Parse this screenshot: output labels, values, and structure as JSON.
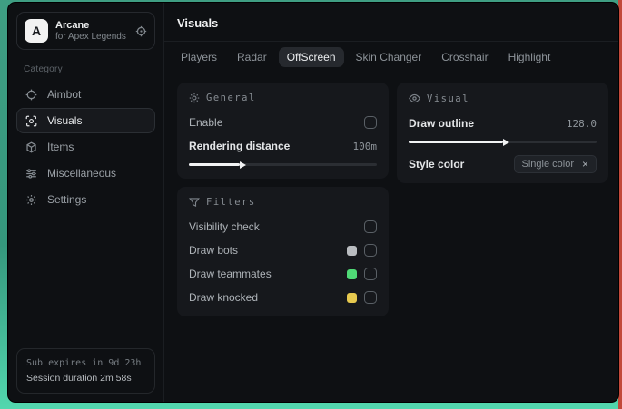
{
  "app": {
    "logo_letter": "A",
    "name": "Arcane",
    "subtitle": "for Apex Legends"
  },
  "sidebar": {
    "category_label": "Category",
    "items": [
      {
        "label": "Aimbot"
      },
      {
        "label": "Visuals"
      },
      {
        "label": "Items"
      },
      {
        "label": "Miscellaneous"
      },
      {
        "label": "Settings"
      }
    ],
    "footer": {
      "sub_expires": "Sub expires in 9d 23h",
      "session_duration": "Session duration 2m 58s"
    }
  },
  "main": {
    "title": "Visuals",
    "tabs": [
      {
        "label": "Players"
      },
      {
        "label": "Radar"
      },
      {
        "label": "OffScreen"
      },
      {
        "label": "Skin Changer"
      },
      {
        "label": "Crosshair"
      },
      {
        "label": "Highlight"
      }
    ],
    "panels": {
      "general": {
        "title": "General",
        "enable_label": "Enable",
        "rendering_distance_label": "Rendering distance",
        "rendering_distance_value": "100m",
        "rendering_distance_fill": "27%"
      },
      "visual": {
        "title": "Visual",
        "draw_outline_label": "Draw outline",
        "draw_outline_value": "128.0",
        "draw_outline_fill": "50%",
        "style_color_label": "Style color",
        "style_color_value": "Single color",
        "style_color_clear": "×"
      },
      "filters": {
        "title": "Filters",
        "rows": [
          {
            "label": "Visibility check",
            "swatch": null
          },
          {
            "label": "Draw bots",
            "swatch": "#b9bcc0"
          },
          {
            "label": "Draw teammates",
            "swatch": "#4fd976"
          },
          {
            "label": "Draw knocked",
            "swatch": "#e6c94f"
          }
        ]
      }
    }
  },
  "colors": {
    "background_teal": "#3f9e83",
    "background_mint": "#52d7ae",
    "background_red_edge": "#c2493a",
    "window_bg": "#0e1013",
    "panel_bg": "#16181c",
    "active_tab_bg": "#26292e",
    "slider_fill": "#f2f3f4"
  }
}
